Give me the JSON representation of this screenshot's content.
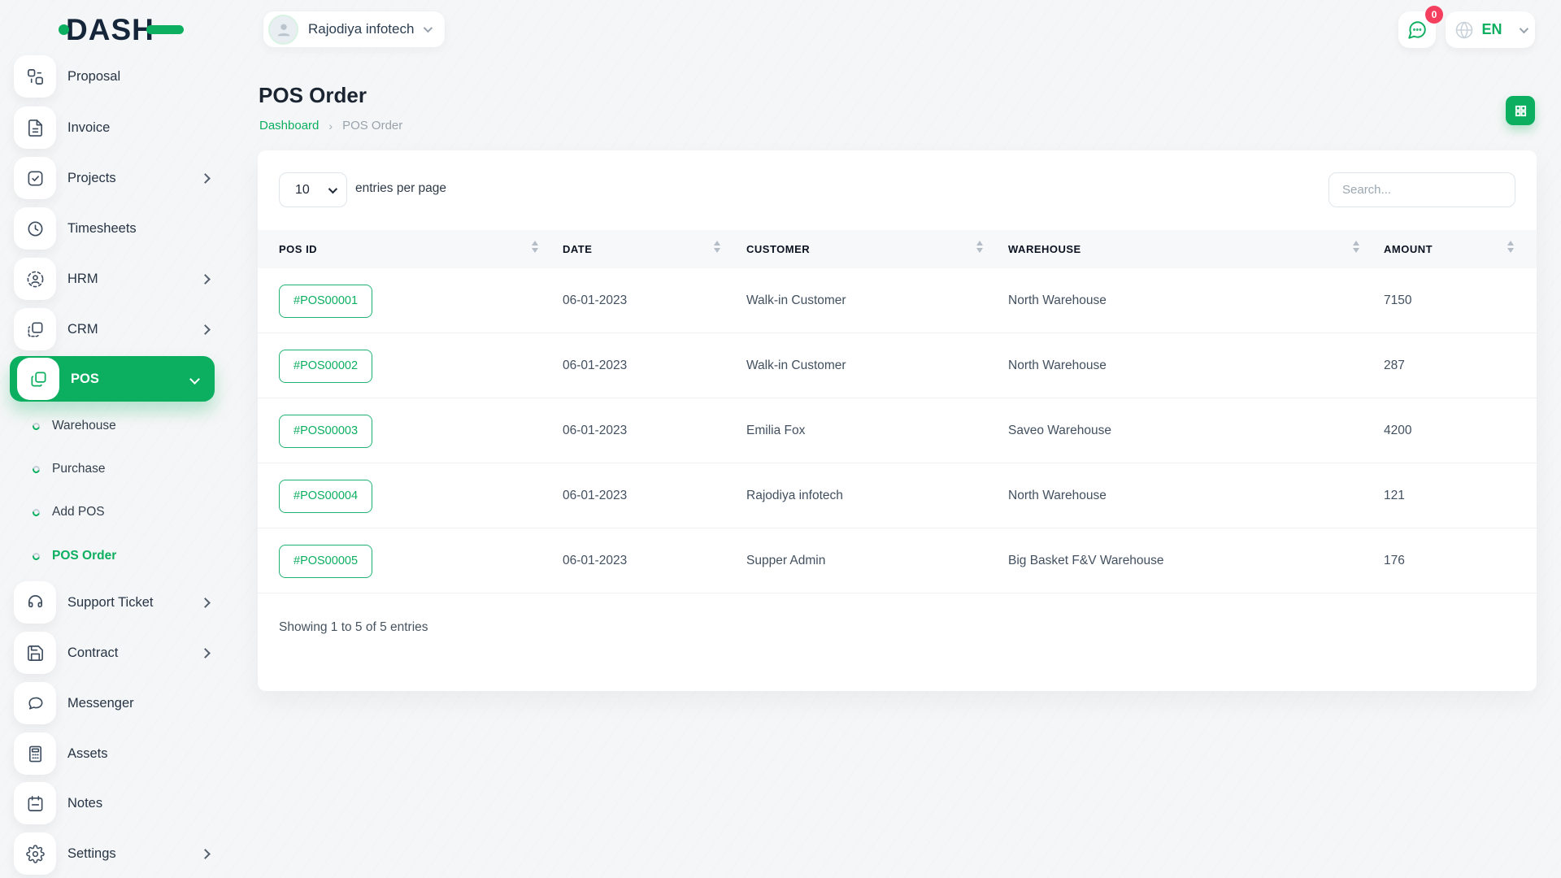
{
  "colors": {
    "accent": "#0caf60",
    "badge": "#f43f5e",
    "dark_navy": "#15263a"
  },
  "brand": {
    "name": "DASH"
  },
  "topbar": {
    "company": "Rajodiya infotech",
    "notification_badge": "0",
    "language": "EN"
  },
  "sidebar": {
    "items": [
      {
        "label": "Proposal"
      },
      {
        "label": "Invoice"
      },
      {
        "label": "Projects"
      },
      {
        "label": "Timesheets"
      },
      {
        "label": "HRM"
      },
      {
        "label": "CRM"
      },
      {
        "label": "POS"
      },
      {
        "label": "Support Ticket"
      },
      {
        "label": "Contract"
      },
      {
        "label": "Messenger"
      },
      {
        "label": "Assets"
      },
      {
        "label": "Notes"
      },
      {
        "label": "Settings"
      }
    ],
    "pos_children": [
      {
        "label": "Warehouse"
      },
      {
        "label": "Purchase"
      },
      {
        "label": "Add POS"
      },
      {
        "label": "POS Order"
      }
    ]
  },
  "page": {
    "title": "POS Order",
    "breadcrumb_home": "Dashboard",
    "breadcrumb_sep": "›",
    "breadcrumb_current": "POS Order"
  },
  "controls": {
    "page_size": "10",
    "entries_label": "entries per page",
    "search_placeholder": "Search..."
  },
  "table": {
    "columns": [
      "POS ID",
      "DATE",
      "CUSTOMER",
      "WAREHOUSE",
      "AMOUNT"
    ],
    "rows": [
      {
        "pos_id": "#POS00001",
        "date": "06-01-2023",
        "customer": "Walk-in Customer",
        "warehouse": "North Warehouse",
        "amount": "7150"
      },
      {
        "pos_id": "#POS00002",
        "date": "06-01-2023",
        "customer": "Walk-in Customer",
        "warehouse": "North Warehouse",
        "amount": "287"
      },
      {
        "pos_id": "#POS00003",
        "date": "06-01-2023",
        "customer": "Emilia Fox",
        "warehouse": "Saveo Warehouse",
        "amount": "4200"
      },
      {
        "pos_id": "#POS00004",
        "date": "06-01-2023",
        "customer": "Rajodiya infotech",
        "warehouse": "North Warehouse",
        "amount": "121"
      },
      {
        "pos_id": "#POS00005",
        "date": "06-01-2023",
        "customer": "Supper Admin",
        "warehouse": "Big Basket F&V Warehouse",
        "amount": "176"
      }
    ],
    "footer": "Showing 1 to 5 of 5 entries"
  }
}
